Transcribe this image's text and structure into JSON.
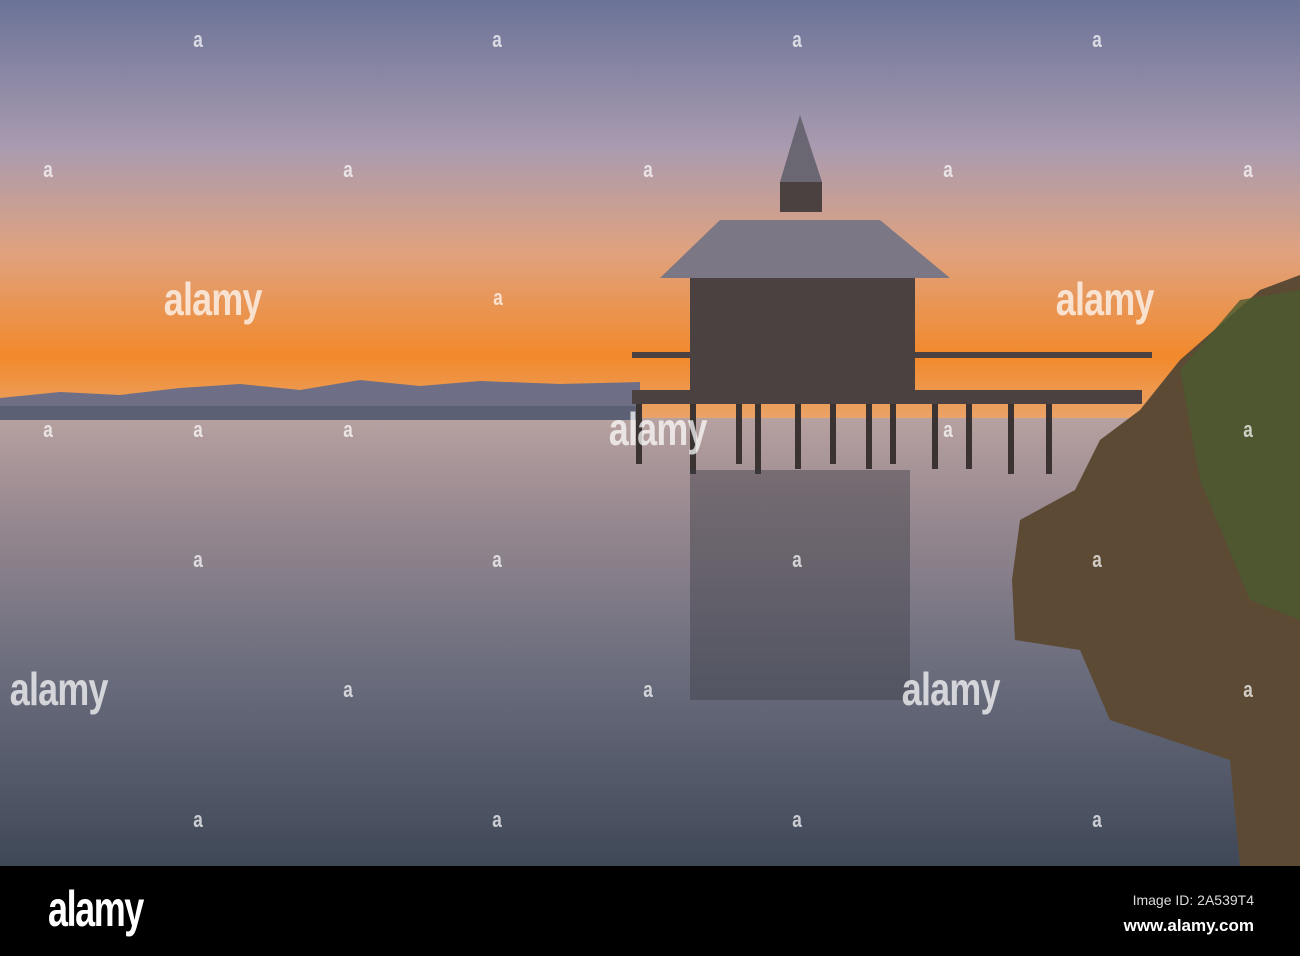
{
  "watermark": {
    "logo_text": "alamy",
    "mark_text": "a"
  },
  "footer": {
    "logo": "alamy",
    "image_id": "Image ID: 2A539T4",
    "url": "www.alamy.com"
  },
  "colors": {
    "sky_top": "#6b7397",
    "horizon": "#f08a2a",
    "water": "#4d5566"
  }
}
